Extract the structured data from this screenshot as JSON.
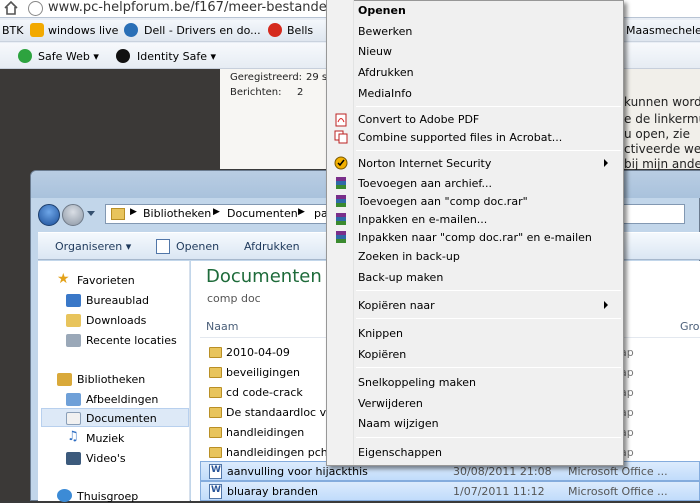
{
  "browser": {
    "url": "www.pc-helpforum.be/f167/meer-bestanden",
    "bookmarks": [
      "BTK",
      "windows live",
      "Dell - Drivers en do...",
      "Bells",
      "Maasmechelen"
    ],
    "safe_web": "Safe Web ▾",
    "identity_safe": "Identity Safe ▾"
  },
  "webpage": {
    "profile": [
      {
        "label": "Geregistreerd:",
        "value": "29 s"
      },
      {
        "label": "Berichten:",
        "value": "2"
      }
    ],
    "side_text": [
      "kunnen word",
      "e de linkermui",
      "u open, zie",
      "ctiveerde we",
      "bij mijn ande"
    ]
  },
  "explorer": {
    "address": [
      "Bibliotheken",
      "Documenten",
      "pa"
    ],
    "toolbar": {
      "organize": "Organiseren ▾",
      "open": "Openen",
      "print": "Afdrukken"
    },
    "nav": {
      "favorites": "Favorieten",
      "fav_items": [
        "Bureaublad",
        "Downloads",
        "Recente locaties"
      ],
      "libraries": "Bibliotheken",
      "lib_items": [
        "Afbeeldingen",
        "Documenten",
        "Muziek",
        "Video's"
      ],
      "homegroup": "Thuisgroep"
    },
    "library_title": "Documenten",
    "library_sub": "comp doc",
    "columns": {
      "name": "Naam",
      "group": "Groe"
    },
    "folders": [
      "2010-04-09",
      "beveiligingen",
      "cd code-crack",
      "De standaardloc van",
      "handleidingen",
      "handleidingen pch"
    ],
    "folder_type": "ap",
    "files": [
      {
        "name": "aanvulling voor hijackthis",
        "date": "30/08/2011 21:08",
        "type": "Microsoft Office ..."
      },
      {
        "name": "bluaray branden",
        "date": "1/07/2011 11:12",
        "type": "Microsoft Office ..."
      }
    ]
  },
  "context_menu": {
    "items": [
      {
        "label": "Openen",
        "bold": true
      },
      {
        "label": "Bewerken"
      },
      {
        "label": "Nieuw"
      },
      {
        "label": "Afdrukken"
      },
      {
        "label": "MediaInfo"
      },
      {
        "label": "Convert to Adobe PDF",
        "icon": "pdf-icon"
      },
      {
        "label": "Combine supported files in Acrobat...",
        "icon": "acrobat-combine-icon"
      },
      {
        "label": "Norton Internet Security",
        "icon": "norton-icon",
        "submenu": true
      },
      {
        "label": "Toevoegen aan archief...",
        "icon": "winrar-icon"
      },
      {
        "label": "Toevoegen aan \"comp doc.rar\"",
        "icon": "winrar-icon"
      },
      {
        "label": "Inpakken en e-mailen...",
        "icon": "winrar-icon"
      },
      {
        "label": "Inpakken naar \"comp doc.rar\" en e-mailen",
        "icon": "winrar-icon"
      },
      {
        "label": "Zoeken in back-up"
      },
      {
        "label": "Back-up maken"
      },
      {
        "label": "Kopiëren naar",
        "submenu": true
      },
      {
        "label": "Knippen"
      },
      {
        "label": "Kopiëren"
      },
      {
        "label": "Snelkoppeling maken"
      },
      {
        "label": "Verwijderen"
      },
      {
        "label": "Naam wijzigen"
      },
      {
        "label": "Eigenschappen"
      }
    ]
  }
}
